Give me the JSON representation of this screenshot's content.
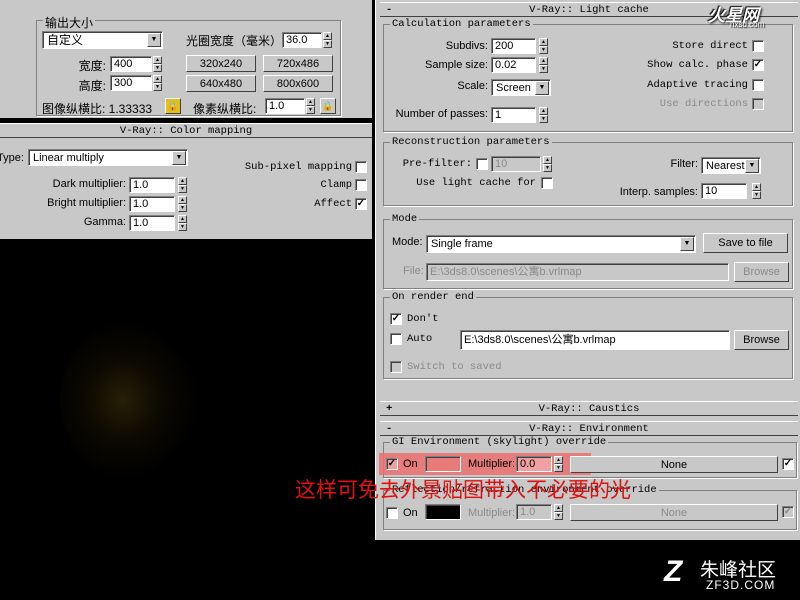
{
  "top_left": {
    "output_size_label": "输出大小",
    "preset": "自定义",
    "aperture_label": "光圈宽度（毫米）:",
    "aperture_value": "36.0",
    "width_label": "宽度:",
    "width_value": "400",
    "height_label": "高度:",
    "height_value": "300",
    "presets": [
      "320x240",
      "720x486",
      "640x480",
      "800x600"
    ],
    "image_aspect_label": "图像纵横比: 1.33333",
    "pixel_aspect_label": "像素纵横比:",
    "pixel_aspect_value": "1.0"
  },
  "color_mapping": {
    "title": "V-Ray:: Color mapping",
    "type_label": "Type:",
    "type_value": "Linear multiply",
    "dark_label": "Dark multiplier:",
    "dark_value": "1.0",
    "bright_label": "Bright multiplier:",
    "bright_value": "1.0",
    "gamma_label": "Gamma:",
    "gamma_value": "1.0",
    "subpixel_label": "Sub-pixel mapping",
    "clamp_label": "Clamp",
    "affect_label": "Affect",
    "affect_check": "✓"
  },
  "light_cache": {
    "sign": "-",
    "title": "V-Ray:: Light cache",
    "calc_group": "Calculation parameters",
    "subdivs_label": "Subdivs:",
    "subdivs_value": "200",
    "sample_size_label": "Sample size:",
    "sample_size_value": "0.02",
    "scale_label": "Scale:",
    "scale_value": "Screen",
    "passes_label": "Number of passes:",
    "passes_value": "1",
    "store_direct_label": "Store direct",
    "show_calc_label": "Show calc. phase",
    "show_calc_check": "✓",
    "adaptive_label": "Adaptive tracing",
    "use_directions_label": "Use directions",
    "recon_group": "Reconstruction parameters",
    "prefilter_label": "Pre-filter:",
    "prefilter_value": "10",
    "use_lc_label": "Use light cache for",
    "filter_label": "Filter:",
    "filter_value": "Nearest",
    "interp_label": "Interp. samples:",
    "interp_value": "10",
    "mode_group": "Mode",
    "mode_label": "Mode:",
    "mode_value": "Single frame",
    "save_to_file": "Save to file",
    "file_label": "File:",
    "file_value": "E:\\3ds8.0\\scenes\\公寓b.vrlmap",
    "browse1": "Browse",
    "on_render_end_group": "On render end",
    "dont_delete_label": "Don't",
    "dont_delete_check": "✓",
    "auto_save_label": "Auto",
    "auto_save_path": "E:\\3ds8.0\\scenes\\公寓b.vrlmap",
    "browse2": "Browse",
    "switch_label": "Switch to saved"
  },
  "caustics": {
    "sign": "+",
    "title": "V-Ray:: Caustics"
  },
  "environment": {
    "sign": "-",
    "title": "V-Ray:: Environment",
    "gi_group": "GI Environment (skylight) override",
    "gi_on_label": "On",
    "gi_on_check": "✓",
    "gi_color": "#e87a7a",
    "gi_multiplier_label": "Multiplier:",
    "gi_multiplier_value": "0.0",
    "gi_map": "None",
    "gi_map_check": "✓",
    "refl_group": "Reflection/refraction environment override",
    "refl_on_label": "On",
    "refl_color": "#000000",
    "refl_multiplier_label": "Multiplier:",
    "refl_multiplier_value": "1.0",
    "refl_map": "None",
    "refl_map_check": "✓"
  },
  "annotation": "这样可免去外景贴图带入不必要的光",
  "watermark_top": "火星网",
  "watermark_top_url": "hxsd.com",
  "watermark_bottom": "朱峰社区",
  "watermark_bottom_url": "ZF3D.COM"
}
